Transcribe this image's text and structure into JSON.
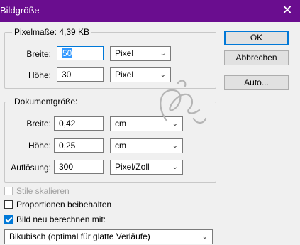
{
  "window": {
    "title": "Bildgröße",
    "close_glyph": "✕"
  },
  "pixel_dims": {
    "title": "Pixelmaße: 4,39 KB",
    "width": {
      "label": "Breite:",
      "value": "50",
      "unit": "Pixel"
    },
    "height": {
      "label": "Höhe:",
      "value": "30",
      "unit": "Pixel"
    }
  },
  "document_size": {
    "title": "Dokumentgröße:",
    "width": {
      "label": "Breite:",
      "value": "0,42",
      "unit": "cm"
    },
    "height": {
      "label": "Höhe:",
      "value": "0,25",
      "unit": "cm"
    },
    "resolution": {
      "label": "Auflösung:",
      "value": "300",
      "unit": "Pixel/Zoll"
    }
  },
  "buttons": {
    "ok": "OK",
    "cancel": "Abbrechen",
    "auto": "Auto..."
  },
  "options": {
    "scale_styles": {
      "label": "Stile skalieren",
      "checked": false,
      "disabled": true
    },
    "constrain": {
      "label": "Proportionen beibehalten",
      "checked": false
    },
    "resample": {
      "label": "Bild neu berechnen mit:",
      "checked": true
    }
  },
  "resample_method": "Bikubisch (optimal für glatte Verläufe)",
  "icons": {
    "dropdown": "chevron-down-icon",
    "close": "close-icon"
  },
  "colors": {
    "titlebar": "#6a0d8f",
    "accent": "#0078d7"
  }
}
